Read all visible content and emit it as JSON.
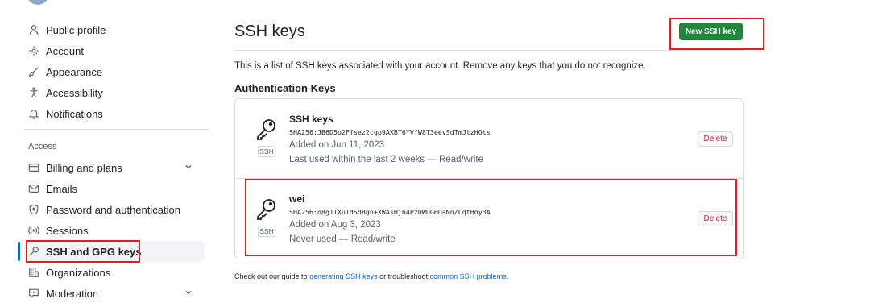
{
  "sidebar": {
    "items_top": [
      {
        "label": "Public profile",
        "icon": "person-icon"
      },
      {
        "label": "Account",
        "icon": "gear-icon"
      },
      {
        "label": "Appearance",
        "icon": "paintbrush-icon"
      },
      {
        "label": "Accessibility",
        "icon": "accessibility-icon"
      },
      {
        "label": "Notifications",
        "icon": "bell-icon"
      }
    ],
    "group_label": "Access",
    "items_access": [
      {
        "label": "Billing and plans",
        "icon": "credit-card-icon"
      },
      {
        "label": "Emails",
        "icon": "mail-icon"
      },
      {
        "label": "Password and authentication",
        "icon": "shield-lock-icon"
      },
      {
        "label": "Sessions",
        "icon": "broadcast-icon"
      },
      {
        "label": "SSH and GPG keys",
        "icon": "key-icon"
      },
      {
        "label": "Organizations",
        "icon": "organization-icon"
      },
      {
        "label": "Moderation",
        "icon": "report-icon"
      }
    ]
  },
  "main": {
    "title": "SSH keys",
    "new_button": "New SSH key",
    "description": "This is a list of SSH keys associated with your account. Remove any keys that you do not recognize.",
    "section_heading": "Authentication Keys",
    "keys": [
      {
        "title": "SSH keys",
        "fingerprint": "SHA256:JB6D5o2Ffsez2cqp9AXBT6YVfW8T3eevSdTmJtzHOts",
        "added": "Added on Jun 11, 2023",
        "last_used": "Last used within the last 2 weeks — Read/write",
        "badge": "SSH",
        "delete_label": "Delete"
      },
      {
        "title": "wei",
        "fingerprint": "SHA256:o8g1IXu1dSd8gn+XWAsHjb4PzDWUGHDaNn/CqtHoy3A",
        "added": "Added on Aug 3, 2023",
        "last_used": "Never used — Read/write",
        "badge": "SSH",
        "delete_label": "Delete"
      }
    ],
    "guide": {
      "prefix": "Check out our guide to ",
      "link1": "generating SSH keys",
      "middle": " or troubleshoot ",
      "link2": "common SSH problems",
      "suffix": "."
    }
  },
  "colors": {
    "primary_button": "#1f883d",
    "link": "#0969da",
    "danger": "#cf222e",
    "highlight_box": "#e02020"
  }
}
